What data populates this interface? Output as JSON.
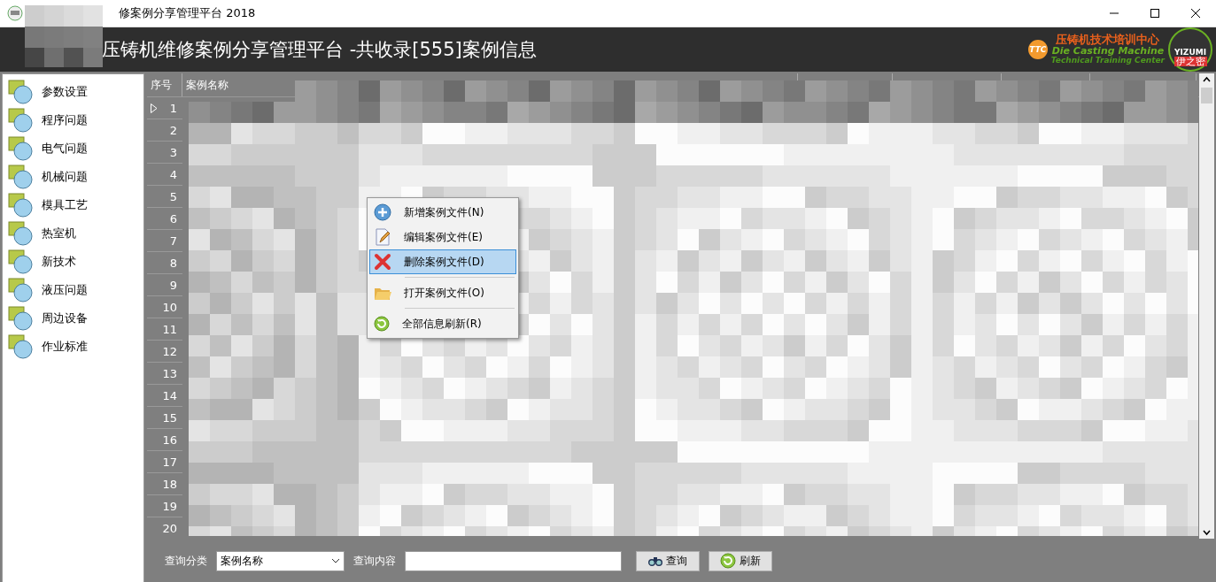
{
  "window": {
    "title": "修案例分享管理平台 2018"
  },
  "header": {
    "title": "压铸机维修案例分享管理平台 -共收录[555]案例信息",
    "logo": {
      "badge": "TTC",
      "name": "压铸机技术培训中心",
      "line1": "Die Casting Machine",
      "line2": "Technical Training Center",
      "seal": "YIZUMI",
      "seal_sub": "伊之密"
    }
  },
  "sidebar": {
    "items": [
      {
        "label": "参数设置"
      },
      {
        "label": "程序问题"
      },
      {
        "label": "电气问题"
      },
      {
        "label": "机械问题"
      },
      {
        "label": "模具工艺"
      },
      {
        "label": "热室机"
      },
      {
        "label": "新技术"
      },
      {
        "label": "液压问题"
      },
      {
        "label": "周边设备"
      },
      {
        "label": "作业标准"
      }
    ]
  },
  "table": {
    "columns": [
      "序号",
      "案例名称"
    ],
    "rows": [
      {
        "number": "1",
        "current": true
      },
      {
        "number": "2",
        "current": false
      },
      {
        "number": "3",
        "current": false
      },
      {
        "number": "4",
        "current": false
      },
      {
        "number": "5",
        "current": false
      },
      {
        "number": "6",
        "current": false
      },
      {
        "number": "7",
        "current": false
      },
      {
        "number": "8",
        "current": false
      },
      {
        "number": "9",
        "current": false
      },
      {
        "number": "10",
        "current": false
      },
      {
        "number": "11",
        "current": false
      },
      {
        "number": "12",
        "current": false
      },
      {
        "number": "13",
        "current": false
      },
      {
        "number": "14",
        "current": false
      },
      {
        "number": "15",
        "current": false
      },
      {
        "number": "16",
        "current": false
      },
      {
        "number": "17",
        "current": false
      },
      {
        "number": "18",
        "current": false
      },
      {
        "number": "19",
        "current": false
      },
      {
        "number": "20",
        "current": false
      }
    ]
  },
  "context_menu": {
    "items": [
      {
        "kind": "add",
        "label": "新增案例文件(N)",
        "selected": false
      },
      {
        "kind": "edit",
        "label": "编辑案例文件(E)",
        "selected": false
      },
      {
        "kind": "delete",
        "label": "删除案例文件(D)",
        "selected": true
      },
      {
        "kind": "open",
        "label": "打开案例文件(O)",
        "selected": false
      },
      {
        "kind": "refresh",
        "label": "全部信息刷新(R)",
        "selected": false
      }
    ]
  },
  "query_bar": {
    "category_label": "查询分类",
    "category_value": "案例名称",
    "content_label": "查询内容",
    "buttons": [
      {
        "kind": "search",
        "label": "查询"
      },
      {
        "kind": "refresh",
        "label": "刷新"
      }
    ]
  }
}
